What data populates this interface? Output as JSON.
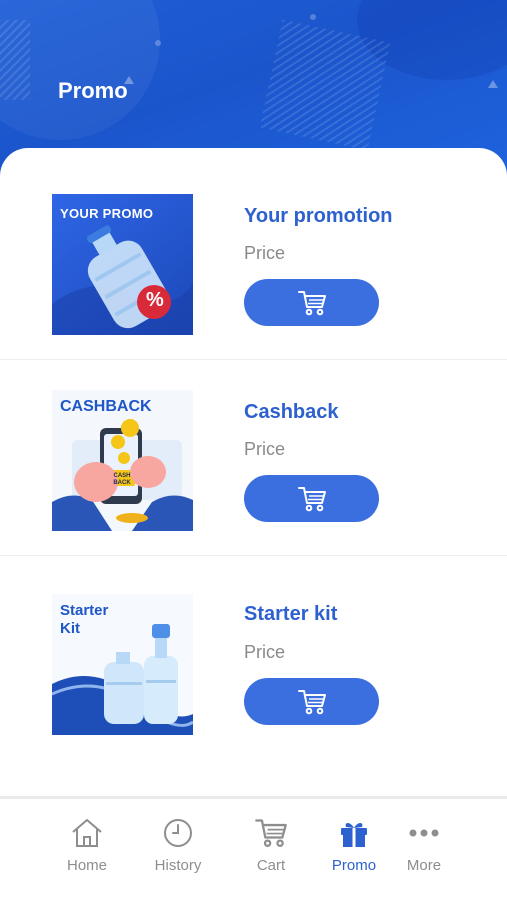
{
  "header": {
    "title": "Promo"
  },
  "promos": [
    {
      "thumb_label": "YOUR PROMO",
      "title": "Your promotion",
      "price": "Price",
      "badge": "%"
    },
    {
      "thumb_label": "CASHBACK",
      "title": "Cashback",
      "price": "Price",
      "badge": "CASH BACK"
    },
    {
      "thumb_label_1": "Starter",
      "thumb_label_2": "Kit",
      "title": "Starter kit",
      "price": "Price"
    }
  ],
  "nav": [
    {
      "label": "Home",
      "icon": "home-icon"
    },
    {
      "label": "History",
      "icon": "clock-icon"
    },
    {
      "label": "Cart",
      "icon": "cart-icon"
    },
    {
      "label": "Promo",
      "icon": "gift-icon",
      "active": true
    },
    {
      "label": "More",
      "icon": "more-dots-icon"
    }
  ],
  "colors": {
    "primary": "#2d61cf",
    "button": "#3b6fe0",
    "header": "#1f5fd6",
    "inactive": "#8e8e8e"
  }
}
